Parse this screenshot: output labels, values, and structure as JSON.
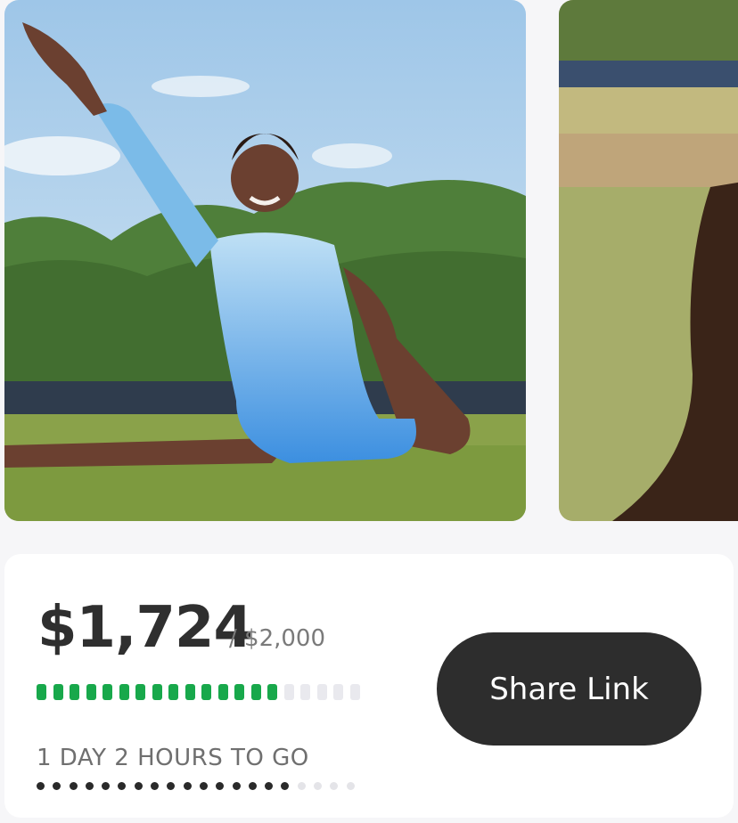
{
  "carousel": {
    "photos": [
      {
        "subject": "gymnast-split-photo"
      },
      {
        "subject": "braided-hair-photo"
      }
    ]
  },
  "campaign": {
    "raised": "$1,724",
    "goal": "/ $2,000",
    "progress_fraction": 0.862,
    "countdown": "1 DAY 2 HOURS TO GO",
    "time_elapsed_fraction": 0.84,
    "share_label": "Share Link"
  },
  "colors": {
    "progress_on": "#18a84b",
    "progress_off": "#e9e9ee",
    "button_bg": "#2d2d2d"
  }
}
